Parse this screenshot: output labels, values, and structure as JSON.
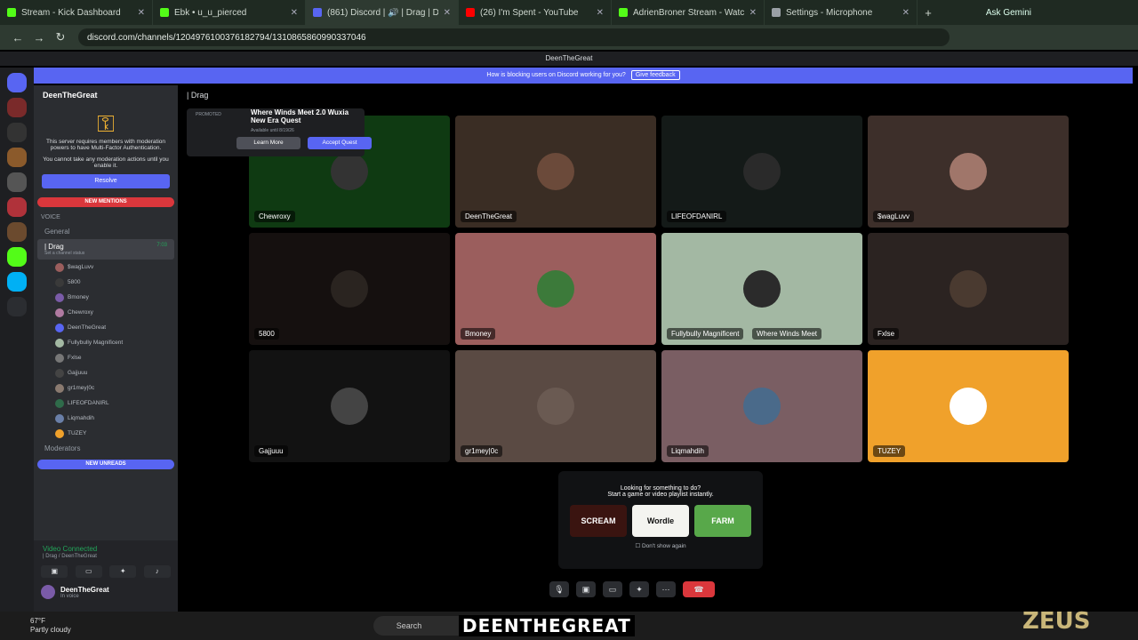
{
  "browser": {
    "tabs": [
      {
        "title": "Stream - Kick Dashboard",
        "color": "#53fc18"
      },
      {
        "title": "Ebk • u_u_pierced",
        "color": "#53fc18"
      },
      {
        "title": "(861) Discord | 🔊 | Drag | D",
        "color": "#5865f2"
      },
      {
        "title": "(26) I'm Spent - YouTube",
        "color": "#ff0000"
      },
      {
        "title": "AdrienBroner Stream - Watch L",
        "color": "#53fc18"
      },
      {
        "title": "Settings - Microphone",
        "color": "#9aa0a6"
      }
    ],
    "url": "discord.com/channels/1204976100376182794/1310865860990337046",
    "ask": "Ask Gemini"
  },
  "discord": {
    "window_title": "DeenTheGreat",
    "banner_text": "How is blocking users on Discord working for you?",
    "banner_button": "Give feedback",
    "server_name": "DeenTheGreat",
    "mfa_text1": "This server requires members with moderation powers to have Multi-Factor Authentication.",
    "mfa_text2": "You cannot take any moderation actions until you enable it.",
    "resolve": "Resolve",
    "new_mentions": "NEW MENTIONS",
    "voice_cat": "VOICE",
    "general": "General",
    "drag": "| Drag",
    "drag_time": "7:03",
    "set_status": "Set a channel status",
    "members": [
      "$wagLuvv",
      "5800",
      "Bmoney",
      "Chewroxy",
      "DeenTheGreat",
      "Fullybully Magnificent",
      "Fxlse",
      "Gajjuuu",
      "gr1mey|0c",
      "LIFEOFDANIRL",
      "Liqmahdih",
      "TUZEY"
    ],
    "moderators": "Moderators",
    "new_unreads": "NEW UNREADS",
    "video_connected": "Video Connected",
    "vc_sub": "| Drag / DeenTheGreat",
    "user_name": "DeenTheGreat",
    "user_status": "In voice",
    "header": "| Drag"
  },
  "promo": {
    "tag": "PROMOTED",
    "title": "Where Winds Meet 2.0 Wuxia New Era Quest",
    "avail": "Available until 8/19/26",
    "learn": "Learn More",
    "accept": "Accept Quest"
  },
  "tiles": [
    {
      "name": "Chewroxy",
      "bg": "#0f3a12"
    },
    {
      "name": "DeenTheGreat",
      "bg": "#3a2d24"
    },
    {
      "name": "LIFEOFDANIRL",
      "bg": "#141a18"
    },
    {
      "name": "$wagLuvv",
      "bg": "#3d2f2a"
    },
    {
      "name": "5800",
      "bg": "#15100f"
    },
    {
      "name": "Bmoney",
      "bg": "#9b5e5d"
    },
    {
      "name": "Fullybully Magnificent",
      "bg": "#a3b8a3"
    },
    {
      "name": "Fxlse",
      "bg": "#2b2321"
    },
    {
      "name": "Gajjuuu",
      "bg": "#121212"
    },
    {
      "name": "gr1mey|0c",
      "bg": "#5a4a43"
    },
    {
      "name": "Liqmahdih",
      "bg": "#7a5e63"
    },
    {
      "name": "TUZEY",
      "bg": "#f0a12b"
    }
  ],
  "fullybully_tag": "Where Winds Meet",
  "lfs": {
    "line1": "Looking for something to do?",
    "line2": "Start a game or video playlist instantly.",
    "games": [
      "SCREAM",
      "Wordle",
      "FARM"
    ],
    "dont_show": "Don't show again"
  },
  "taskbar": {
    "temp": "67°F",
    "weather": "Partly cloudy",
    "search": "Search"
  },
  "overlay_text": "DEENTHEGREAT",
  "watermark": "ZEUS"
}
